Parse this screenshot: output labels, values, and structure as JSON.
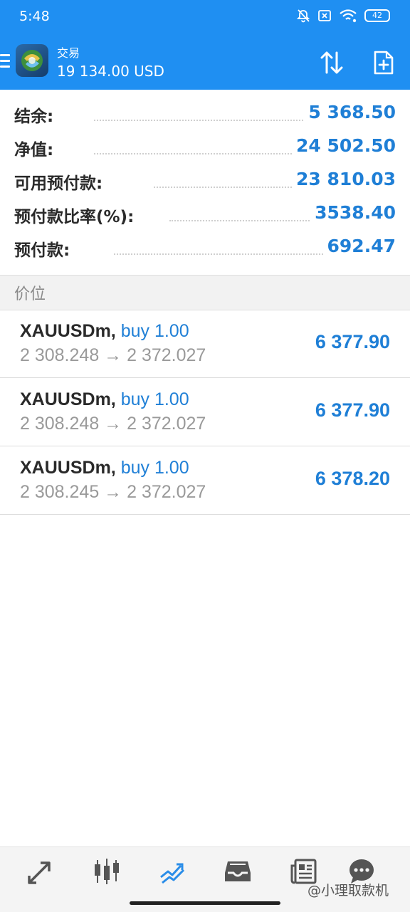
{
  "status_bar": {
    "time": "5:48",
    "battery": "42"
  },
  "header": {
    "title": "交易",
    "balance": "19 134.00 USD"
  },
  "summary": [
    {
      "label": "结余:",
      "value": "5 368.50"
    },
    {
      "label": "净值:",
      "value": "24 502.50"
    },
    {
      "label": "可用预付款:",
      "value": "23 810.03"
    },
    {
      "label": "预付款比率(%):",
      "value": "3538.40"
    },
    {
      "label": "预付款:",
      "value": "692.47"
    }
  ],
  "section": {
    "title": "价位"
  },
  "positions": [
    {
      "symbol": "XAUUSDm,",
      "side": "buy 1.00",
      "prices": "2 308.248 → 2 372.027",
      "profit": "6 377.90"
    },
    {
      "symbol": "XAUUSDm,",
      "side": "buy 1.00",
      "prices": "2 308.248 → 2 372.027",
      "profit": "6 377.90"
    },
    {
      "symbol": "XAUUSDm,",
      "side": "buy 1.00",
      "prices": "2 308.245 → 2 372.027",
      "profit": "6 378.20"
    }
  ],
  "bottom_nav": {
    "items": [
      {
        "icon": "quotes-arrows-icon"
      },
      {
        "icon": "chart-candles-icon"
      },
      {
        "icon": "trade-icon",
        "active": true
      },
      {
        "icon": "history-inbox-icon"
      },
      {
        "icon": "news-icon"
      },
      {
        "icon": "chat-icon"
      }
    ]
  },
  "watermark": "@小理取款机",
  "colors": {
    "header_blue": "#1f8ff2",
    "value_blue": "#1f7fd6",
    "active_tab": "#2a8de8"
  }
}
